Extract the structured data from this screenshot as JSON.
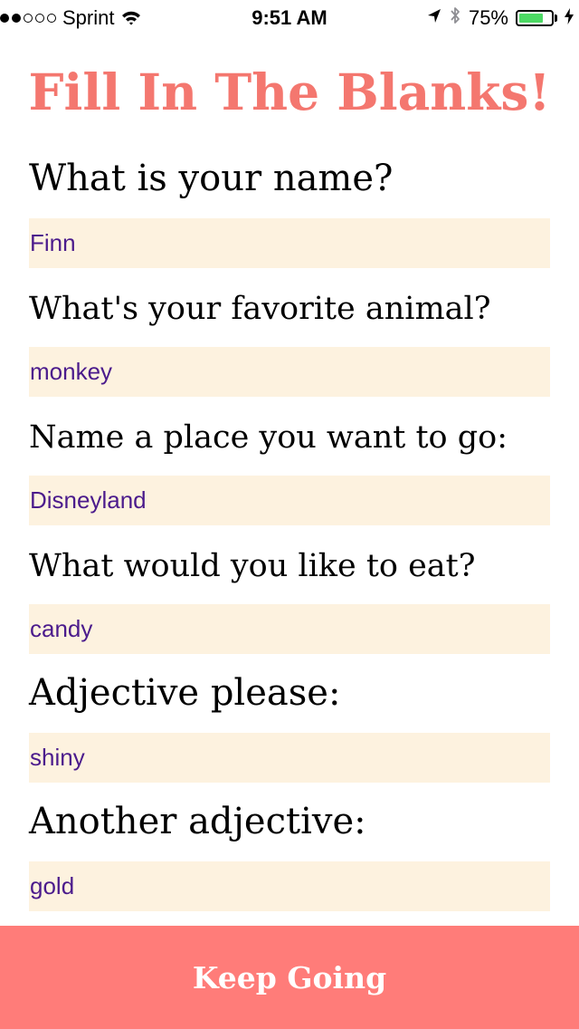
{
  "status_bar": {
    "signal_bars_filled": 2,
    "signal_bars_total": 5,
    "carrier": "Sprint",
    "time": "9:51 AM",
    "battery_percent": "75%",
    "battery_level": 0.75,
    "icons": [
      "wifi-icon",
      "location-arrow-icon",
      "bluetooth-icon",
      "battery-icon",
      "charging-bolt-icon"
    ]
  },
  "title": "Fill In The Blanks!",
  "form": {
    "fields": [
      {
        "question": "What is your name?",
        "value": "Finn"
      },
      {
        "question": "What's your favorite animal?",
        "value": "monkey"
      },
      {
        "question": "Name a place you want to go:",
        "value": "Disneyland"
      },
      {
        "question": "What would you like to eat?",
        "value": "candy"
      },
      {
        "question": "Adjective please:",
        "value": "shiny"
      },
      {
        "question": "Another adjective:",
        "value": "gold"
      }
    ]
  },
  "button": {
    "label": "Keep Going"
  },
  "colors": {
    "title": "#f4776f",
    "field_background": "#fdf2df",
    "field_text": "#4b1b8c",
    "button_background": "#ff7c79",
    "battery_fill": "#4cd964"
  }
}
